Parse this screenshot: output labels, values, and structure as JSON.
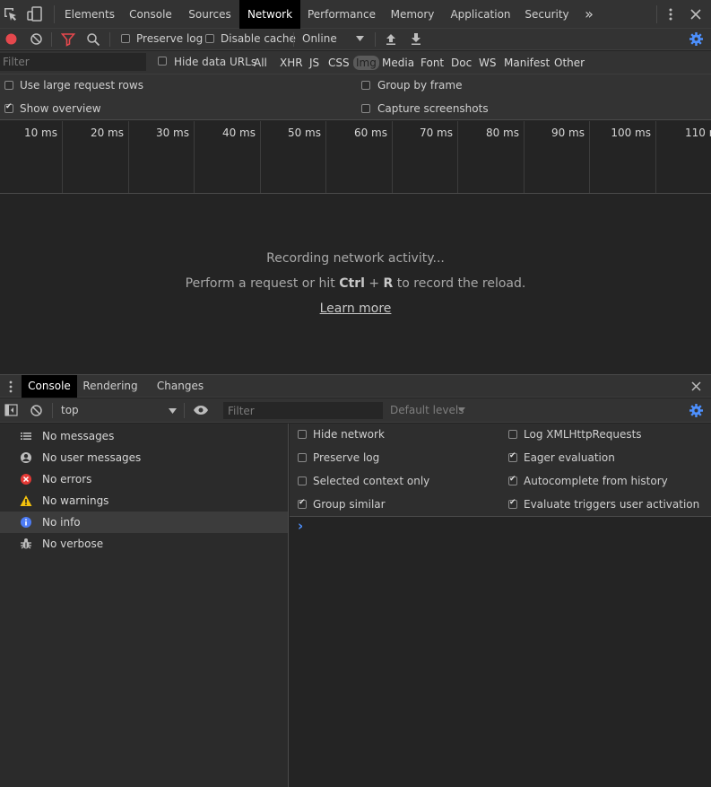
{
  "top_tabs": [
    "Elements",
    "Console",
    "Sources",
    "Network",
    "Performance",
    "Memory",
    "Application",
    "Security"
  ],
  "active_top_tab": "Network",
  "overflow_glyph": "»",
  "network_toolbar": {
    "preserve_log": "Preserve log",
    "disable_cache": "Disable cache",
    "throttling": "Online"
  },
  "filter_bar": {
    "placeholder": "Filter",
    "hide_data_urls": "Hide data URLs",
    "types": [
      "All",
      "XHR",
      "JS",
      "CSS",
      "Img",
      "Media",
      "Font",
      "Doc",
      "WS",
      "Manifest",
      "Other"
    ],
    "selected_type": "Img"
  },
  "settings": {
    "large_rows": "Use large request rows",
    "show_overview": "Show overview",
    "group_by_frame": "Group by frame",
    "capture_screenshots": "Capture screenshots",
    "show_overview_checked": true
  },
  "overview_ticks": [
    "10 ms",
    "20 ms",
    "30 ms",
    "40 ms",
    "50 ms",
    "60 ms",
    "70 ms",
    "80 ms",
    "90 ms",
    "100 ms",
    "110 ms"
  ],
  "empty_state": {
    "recording": "Recording network activity...",
    "perform_prefix": "Perform a request or hit",
    "key_ctrl": "Ctrl",
    "key_plus": "+",
    "key_r": "R",
    "perform_suffix": "to record the reload.",
    "learn_more": "Learn more"
  },
  "drawer_tabs": [
    "Console",
    "Rendering",
    "Changes"
  ],
  "active_drawer_tab": "Console",
  "console_toolbar": {
    "context": "top",
    "filter_placeholder": "Filter",
    "levels": "Default levels"
  },
  "sidebar_items": [
    {
      "label": "No messages",
      "icon": "list-icon"
    },
    {
      "label": "No user messages",
      "icon": "user-icon"
    },
    {
      "label": "No errors",
      "icon": "error-icon"
    },
    {
      "label": "No warnings",
      "icon": "warning-icon"
    },
    {
      "label": "No info",
      "icon": "info-icon"
    },
    {
      "label": "No verbose",
      "icon": "bug-icon"
    }
  ],
  "selected_sidebar_item": "No info",
  "console_settings": {
    "left": [
      {
        "label": "Hide network",
        "checked": false
      },
      {
        "label": "Preserve log",
        "checked": false
      },
      {
        "label": "Selected context only",
        "checked": false
      },
      {
        "label": "Group similar",
        "checked": true
      }
    ],
    "right": [
      {
        "label": "Log XMLHttpRequests",
        "checked": false
      },
      {
        "label": "Eager evaluation",
        "checked": true
      },
      {
        "label": "Autocomplete from history",
        "checked": true
      },
      {
        "label": "Evaluate triggers user activation",
        "checked": true
      }
    ]
  },
  "console_prompt": "›",
  "colors": {
    "accent_blue": "#4d90fe",
    "record_red": "#e5484d",
    "filter_red": "#e5484d",
    "error_red": "#e53935",
    "warning_yellow": "#f4c20d",
    "info_blue": "#4d7cf5"
  }
}
